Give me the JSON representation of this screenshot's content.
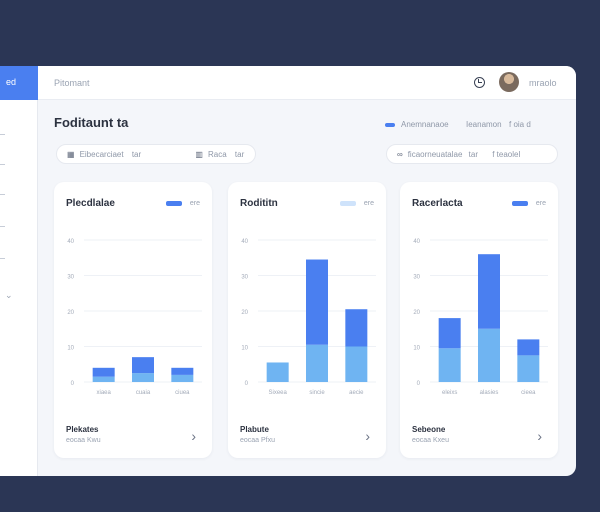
{
  "colors": {
    "accent": "#4a7ff0",
    "bar_top": "#4a7ff0",
    "bar_bottom": "#6fb4f2",
    "background": "#2b3655"
  },
  "sidebar": {
    "active_label": "ed",
    "icons": [
      "nav-icon",
      "nav-icon",
      "nav-icon",
      "nav-icon",
      "nav-icon",
      "chevron-icon"
    ]
  },
  "header": {
    "breadcrumb": "Pitomant",
    "user_name": "mraolo",
    "icons": [
      "clock-icon",
      "avatar"
    ]
  },
  "page": {
    "title": "Foditaunt ta",
    "legend": [
      {
        "label": "Anemnanaoe",
        "color": "#4a7ff0"
      },
      {
        "label": "Ieanamon",
        "color": "#3a4254"
      },
      {
        "label": "f  oia   d",
        "color": "#8f98a8"
      }
    ]
  },
  "filters": {
    "left": {
      "icon": "calendar-icon",
      "value": "Eibecarciaet",
      "suffix": "tar"
    },
    "middle": {
      "icon": "grid-icon",
      "value": "Raca",
      "suffix": "tar"
    },
    "right": {
      "icon": "link-icon",
      "value": "ficaorneuatalae",
      "suffix": "tar",
      "extra": "f  teaolel"
    }
  },
  "chart_data": [
    {
      "type": "bar",
      "title": "Plecdlalae",
      "legend": [
        "ere"
      ],
      "categories": [
        "xiaea",
        "cuaia",
        "ciuea"
      ],
      "series": [
        {
          "values": [
            1.5,
            2.5,
            2.0
          ]
        },
        {
          "values": [
            2.5,
            4.5,
            2.0
          ]
        }
      ],
      "yticks": [
        "40",
        "30",
        "20",
        "10",
        "0"
      ],
      "ylim": [
        0,
        40
      ],
      "foot_title": "Plekates",
      "foot_sub": "eocaa  Kwu"
    },
    {
      "type": "bar",
      "title": "Rodititn",
      "legend": [
        "ere"
      ],
      "categories": [
        "Sixeea",
        "sincie",
        "aecie"
      ],
      "series": [
        {
          "values": [
            5.5,
            10.5,
            10.0
          ]
        },
        {
          "values": [
            0.0,
            24.0,
            10.5
          ]
        }
      ],
      "yticks": [
        "40",
        "30",
        "20",
        "10",
        "0"
      ],
      "ylim": [
        0,
        40
      ],
      "foot_title": "Plabute",
      "foot_sub": "eocaa  Pfxu"
    },
    {
      "type": "bar",
      "title": "Racerlacta",
      "legend": [
        "ere"
      ],
      "categories": [
        "eleixs",
        "alasies",
        "cieea"
      ],
      "series": [
        {
          "values": [
            9.5,
            15.0,
            7.5
          ]
        },
        {
          "values": [
            8.5,
            21.0,
            4.5
          ]
        }
      ],
      "yticks": [
        "40",
        "30",
        "20",
        "10",
        "0"
      ],
      "ylim": [
        0,
        40
      ],
      "foot_title": "Sebeone",
      "foot_sub": "eocaa  Kxeu"
    }
  ]
}
